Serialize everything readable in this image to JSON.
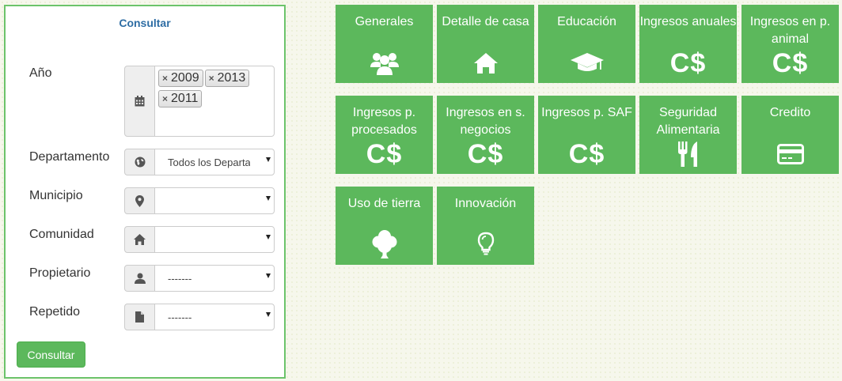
{
  "form": {
    "title": "Consultar",
    "year_label": "Año",
    "year_tags": [
      "2009",
      "2013",
      "2011"
    ],
    "department_label": "Departamento",
    "department_value": "Todos los Departamentos",
    "municipality_label": "Municipio",
    "municipality_value": "",
    "community_label": "Comunidad",
    "community_value": "",
    "owner_label": "Propietario",
    "owner_value": "-------",
    "repeated_label": "Repetido",
    "repeated_value": "-------",
    "submit_label": "Consultar"
  },
  "tiles": [
    {
      "label": "Generales",
      "icon": "users-icon"
    },
    {
      "label": "Detalle de casa",
      "icon": "home-icon"
    },
    {
      "label": "Educación",
      "icon": "graduation-cap-icon"
    },
    {
      "label": "Ingresos anuales",
      "icon": "currency-icon",
      "symbol": "C$"
    },
    {
      "label": "Ingresos en p. animal",
      "icon": "currency-icon",
      "symbol": "C$"
    },
    {
      "label": "Ingresos p. procesados",
      "icon": "currency-icon",
      "symbol": "C$"
    },
    {
      "label": "Ingresos en s. negocios",
      "icon": "currency-icon",
      "symbol": "C$"
    },
    {
      "label": "Ingresos p. SAF",
      "icon": "currency-icon",
      "symbol": "C$"
    },
    {
      "label": "Seguridad Alimentaria",
      "icon": "cutlery-icon"
    },
    {
      "label": "Credito",
      "icon": "credit-card-icon"
    },
    {
      "label": "Uso de tierra",
      "icon": "tree-icon"
    },
    {
      "label": "Innovación",
      "icon": "lightbulb-icon"
    }
  ],
  "colors": {
    "tile_green": "#5cb85c",
    "panel_border": "#6cc36a",
    "title_blue": "#2e6da4"
  }
}
